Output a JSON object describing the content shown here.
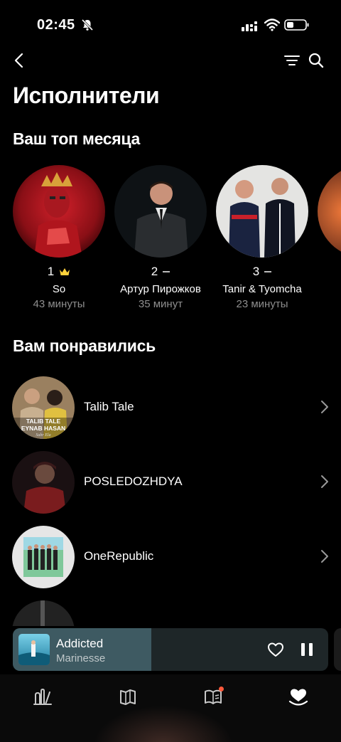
{
  "status_bar": {
    "time": "02:45"
  },
  "page": {
    "title": "Исполнители"
  },
  "top_month": {
    "title": "Ваш топ месяца",
    "artists": [
      {
        "rank": "1",
        "trend": "crown",
        "name": "So",
        "time": "43 минуты"
      },
      {
        "rank": "2",
        "trend": "same",
        "name": "Артур Пирожков",
        "time": "35 минут"
      },
      {
        "rank": "3",
        "trend": "same",
        "name": "Tanir & Tyomcha",
        "time": "23 минуты"
      }
    ]
  },
  "liked": {
    "title": "Вам понравились",
    "artists": [
      {
        "name": "Talib Tale",
        "cover_text": [
          "TALIB TALE",
          "EYNAB HASAN",
          "Sabr Ela"
        ]
      },
      {
        "name": "POSLEDOZHDYA"
      },
      {
        "name": "OneRepublic"
      }
    ]
  },
  "player": {
    "title": "Addicted",
    "artist": "Marinesse",
    "progress": 0.44
  },
  "tabs": [
    {
      "name": "tab-music-library",
      "icon": "bars-icon"
    },
    {
      "name": "tab-explore",
      "icon": "map-icon"
    },
    {
      "name": "tab-books-podcasts",
      "icon": "book-icon",
      "badge": true
    },
    {
      "name": "tab-collection",
      "icon": "heart-icon",
      "active": true
    }
  ],
  "colors": {
    "accent": "#ffd23c",
    "badge": "#ff5a3c",
    "background": "#000000",
    "secondary_text": "#8e8e8e"
  },
  "icons": {
    "status": [
      "bell-off-icon",
      "signal-icon",
      "wifi-icon",
      "battery-icon"
    ],
    "nav": [
      "back-arrow-icon",
      "filter-icon",
      "search-icon"
    ],
    "list": "chevron-right-icon",
    "player": [
      "heart-outline-icon",
      "pause-icon"
    ]
  }
}
